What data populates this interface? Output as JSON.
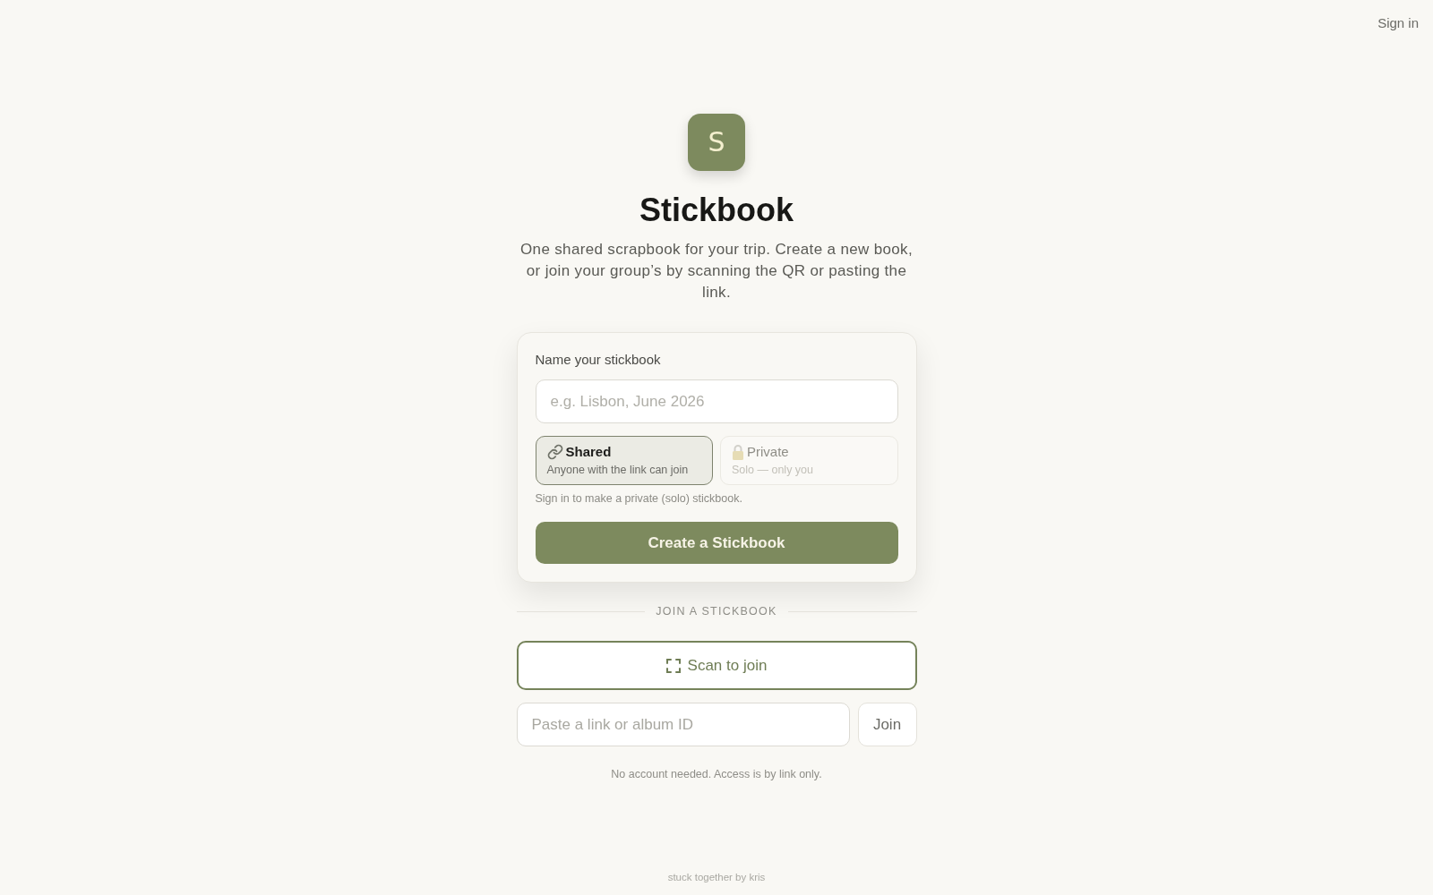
{
  "header": {
    "sign_in": "Sign in"
  },
  "brand": {
    "logo_letter": "S",
    "title": "Stickbook",
    "description": "One shared scrapbook for your trip. Create a new book, or join your group’s by scanning the QR or pasting the link."
  },
  "create_card": {
    "label": "Name your stickbook",
    "name_field": {
      "placeholder": "e.g. Lisbon, June 2026"
    },
    "visibility_options": [
      {
        "kind": "shared",
        "title": "Shared",
        "subtitle": "Anyone with the link can join",
        "selected": true,
        "disabled": false
      },
      {
        "kind": "private",
        "title": "Private",
        "subtitle": "Solo — only you",
        "selected": false,
        "disabled": true
      }
    ],
    "hint": "Sign in to make a private (solo) stickbook.",
    "create_button": "Create a Stickbook"
  },
  "join": {
    "divider_label": "JOIN A STICKBOOK",
    "scan_button": "Scan to join",
    "link_field": {
      "placeholder": "Paste a link or album ID"
    },
    "join_button": "Join",
    "note": "No account needed. Access is by link only."
  },
  "footer": "stuck together by kris"
}
